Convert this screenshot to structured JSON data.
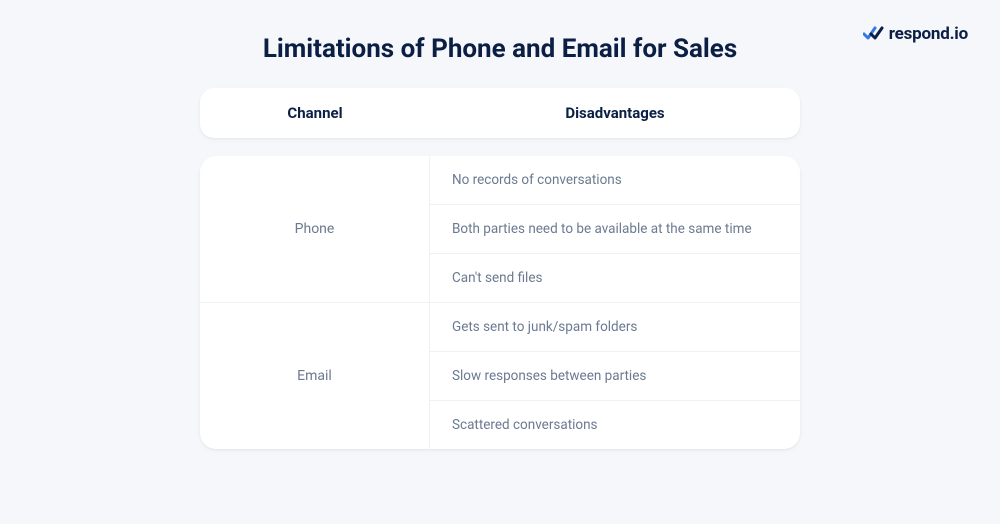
{
  "brand": {
    "name": "respond.io"
  },
  "title": "Limitations of Phone and Email for Sales",
  "table": {
    "headers": {
      "channel": "Channel",
      "disadvantages": "Disadvantages"
    },
    "rows": [
      {
        "channel": "Phone",
        "items": [
          "No records of conversations",
          "Both parties need to be available at the same time",
          "Can't send files"
        ]
      },
      {
        "channel": "Email",
        "items": [
          "Gets sent to junk/spam folders",
          "Slow responses between parties",
          "Scattered conversations"
        ]
      }
    ]
  }
}
